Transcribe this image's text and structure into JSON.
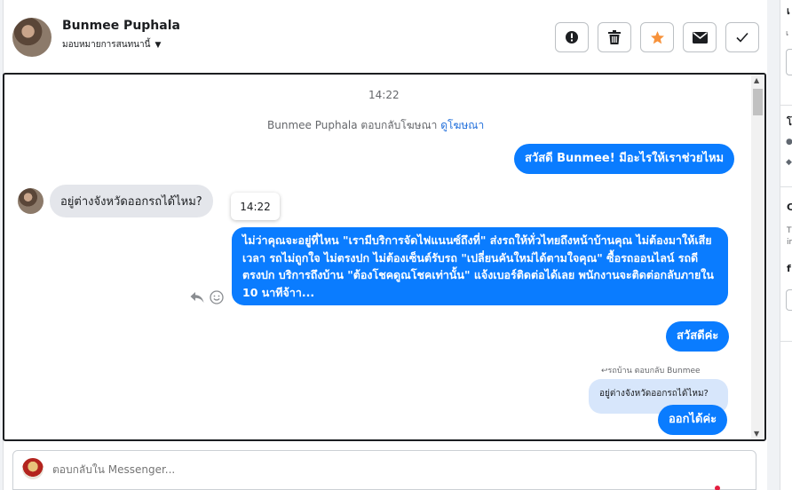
{
  "contact": {
    "name": "Bunmee Puphala",
    "assign_label": "มอบหมายการสนทนานี้"
  },
  "toolbar": {
    "buttons": [
      {
        "name": "mark-spam-button",
        "icon": "alert-circle-icon"
      },
      {
        "name": "delete-button",
        "icon": "trash-icon"
      },
      {
        "name": "star-button",
        "icon": "star-icon"
      },
      {
        "name": "mark-unread-button",
        "icon": "envelope-icon"
      },
      {
        "name": "mark-done-button",
        "icon": "checkmark-icon"
      }
    ],
    "star_color": "#f7923b"
  },
  "chat": {
    "timestamp": "14:22",
    "system_text": "Bunmee Puphala ตอบกลับโฆษณา",
    "system_link": "ดูโฆษณา",
    "greeting": "สวัสดี Bunmee! มีอะไรให้เราช่วยไหม",
    "incoming": "อยู่ต่างจังหวัดออกรถได้ไหม?",
    "tooltip_time": "14:22",
    "long_reply": "ไม่ว่าคุณจะอยู่ที่ไหน \"เรามีบริการจัดไฟแนนซ์ถึงที่\"  ส่งรถให้ทั่วไทยถึงหน้าบ้านคุณ ไม่ต้องมาให้เสียเวลา รถไม่ถูกใจ ไม่ตรงปก ไม่ต้องเซ็นต์รับรถ \"เปลี่ยนคันใหม่ได้ตามใจคุณ\" ซื้อรถออนไลน์ รถดี ตรงปก บริการถึงบ้าน \"ต้องโชคดูณโชคเท่านั้น\" แจ้งเบอร์ติดต่อได้เลย พนักงานจะติดต่อกลับภายใน 10 นาทีจ้าา...",
    "hello_ka": "สวัสดีค่ะ",
    "reply_label": "รถบ้าน ตอบกลับ Bunmee",
    "quoted_text": "อยู่ต่างจังหวัดออกรถได้ไหม?",
    "final_reply": "ออกได้ค่ะ",
    "bubble_color": "#0a7cff"
  },
  "composer": {
    "placeholder": "ตอบกลับใน Messenger..."
  },
  "sidebar": {
    "frag_1": "เ",
    "frag_2": "เ",
    "frag_3": "โ",
    "frag_4": "C",
    "frag_5": "T",
    "frag_6": "in",
    "frag_7": "f"
  }
}
